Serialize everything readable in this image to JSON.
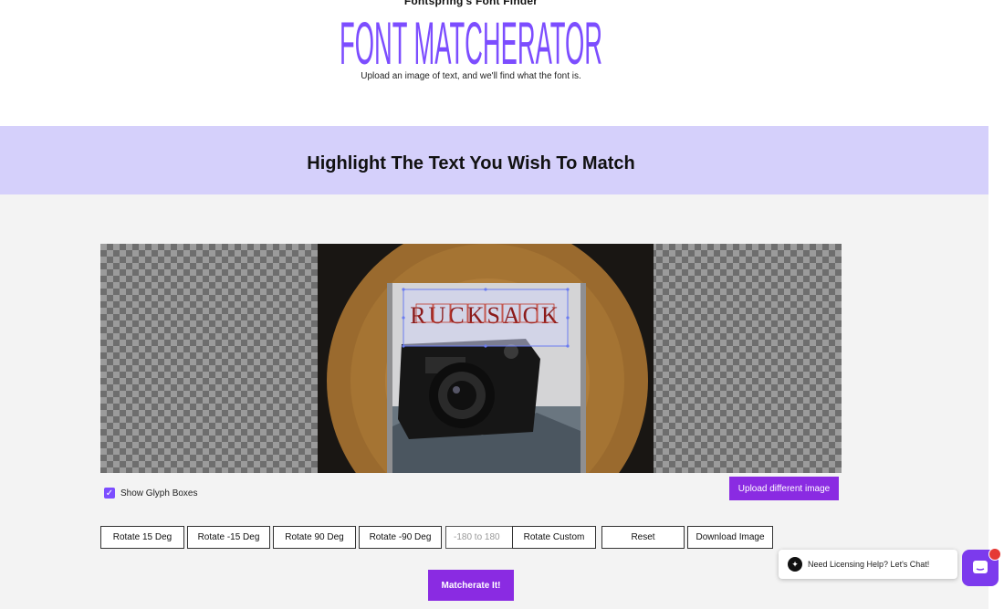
{
  "header": {
    "kicker": "Fontspring's Font Finder",
    "logo_text": "FONT MATCHERATOR",
    "subtitle": "Upload an image of text, and we'll find what the font is."
  },
  "band": {
    "title": "Highlight The Text You Wish To Match"
  },
  "image": {
    "cover_text": "RUCKSACK",
    "glyph_checkbox_label": "Show Glyph Boxes",
    "glyph_checkbox_checked": true
  },
  "buttons": {
    "upload_different": "Upload different image",
    "rotate_15": "Rotate 15 Deg",
    "rotate_m15": "Rotate -15 Deg",
    "rotate_90": "Rotate 90 Deg",
    "rotate_m90": "Rotate -90 Deg",
    "rotate_custom": "Rotate Custom",
    "reset": "Reset",
    "download": "Download Image",
    "matcherate": "Matcherate It!"
  },
  "inputs": {
    "rotate_placeholder": "-180 to 180"
  },
  "chat": {
    "text": "Need Licensing Help? Let's Chat!"
  },
  "colors": {
    "accent": "#8a2be2",
    "logo": "#7c4dff",
    "band": "#d5d0fb",
    "glyph_box": "#c0392b"
  }
}
